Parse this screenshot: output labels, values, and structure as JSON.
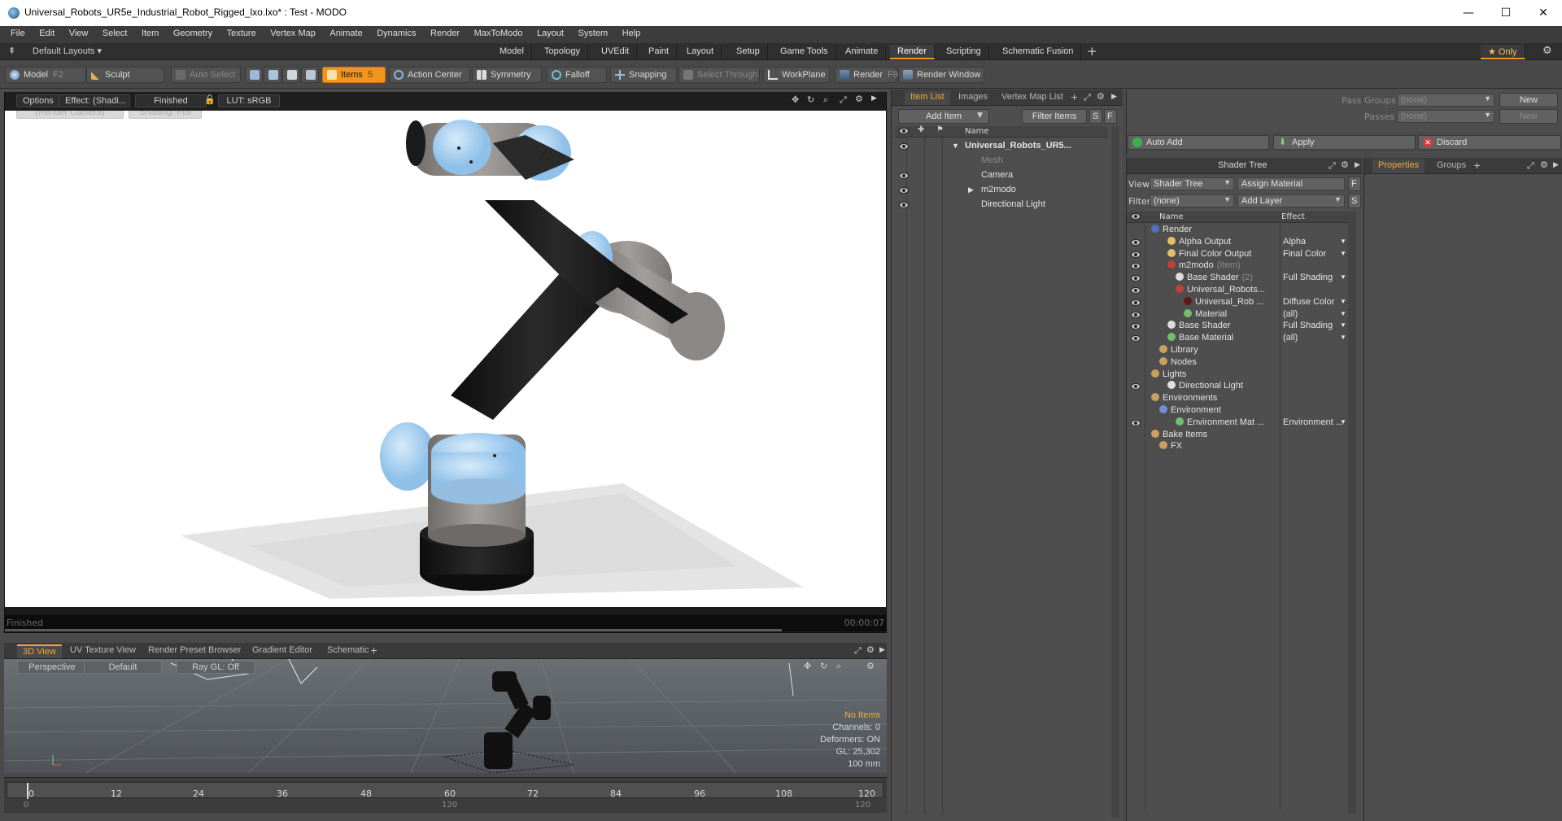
{
  "window": {
    "title": "Universal_Robots_UR5e_Industrial_Robot_Rigged_lxo.lxo* : Test - MODO",
    "minimize": "—",
    "maximize": "☐",
    "close": "✕"
  },
  "menu": [
    "File",
    "Edit",
    "View",
    "Select",
    "Item",
    "Geometry",
    "Texture",
    "Vertex Map",
    "Animate",
    "Dynamics",
    "Render",
    "MaxToModo",
    "Layout",
    "System",
    "Help"
  ],
  "layouts": {
    "default_label": "Default Layouts ▾",
    "tabs": [
      "Model",
      "Topology",
      "UVEdit",
      "Paint",
      "Layout",
      "Setup",
      "Game Tools",
      "Animate",
      "Render",
      "Scripting",
      "Schematic Fusion"
    ],
    "active_tab": "Render",
    "add": "+",
    "only_label": "★ Only"
  },
  "toolbar": {
    "model": "Model",
    "model_key": "F2",
    "sculpt": "Sculpt",
    "auto_select": "Auto Select",
    "items": "Items",
    "items_key": "5",
    "action_center": "Action Center",
    "symmetry": "Symmetry",
    "falloff": "Falloff",
    "snapping": "Snapping",
    "select_through": "Select Through",
    "workplane": "WorkPlane",
    "render": "Render",
    "render_key": "F9",
    "render_window": "Render Window"
  },
  "viewport": {
    "options": "Options",
    "effect": "Effect: (Shadi...",
    "finished_label": "Finished",
    "lut": "LUT: sRGB",
    "camera": "(Render Camera)",
    "shading": "Shading: Full",
    "status": "Finished",
    "time": "00:00:07"
  },
  "lower_tabs": [
    "3D View",
    "UV Texture View",
    "Render Preset Browser",
    "Gradient Editor",
    "Schematic"
  ],
  "view3d": {
    "perspective": "Perspective",
    "default": "Default",
    "raygl": "Ray GL: Off",
    "no_items": "No Items",
    "channels": "Channels: 0",
    "deformers": "Deformers: ON",
    "gl": "GL: 25,302",
    "scale": "100 mm"
  },
  "timeline": {
    "ticks": [
      "0",
      "12",
      "24",
      "36",
      "48",
      "60",
      "72",
      "84",
      "96",
      "108",
      "120"
    ],
    "bottom_left": "0",
    "bottom_mid": "120",
    "bottom_right": "120"
  },
  "item_list": {
    "tabs": [
      "Item List",
      "Images",
      "Vertex Map List"
    ],
    "add_item": "Add Item",
    "filter_items": "Filter Items",
    "s": "S",
    "f": "F",
    "col_name": "Name",
    "rows": [
      {
        "label": "Universal_Robots_UR5...",
        "bold": true,
        "indent": 0
      },
      {
        "label": "Mesh",
        "muted": true,
        "indent": 1
      },
      {
        "label": "Camera",
        "indent": 1
      },
      {
        "label": "m2modo",
        "indent": 1
      },
      {
        "label": "Directional Light",
        "indent": 1
      }
    ]
  },
  "pass_groups": {
    "pass_groups_label": "Pass Groups",
    "passes_label": "Passes",
    "none1": "(none)",
    "none2": "(none)",
    "new1": "New",
    "new2": "New"
  },
  "actions": {
    "auto_add": "Auto Add",
    "apply": "Apply",
    "discard": "Discard"
  },
  "shader_tree": {
    "title": "Shader Tree",
    "view_label": "View",
    "view_value": "Shader Tree",
    "assign_material": "Assign Material",
    "filter_label": "Filter",
    "filter_value": "(none)",
    "add_layer": "Add Layer",
    "f": "F",
    "s": "S",
    "col_name": "Name",
    "col_effect": "Effect",
    "rows": [
      {
        "label": "Render",
        "effect": "",
        "eye": false,
        "indent": 0
      },
      {
        "label": "Alpha Output",
        "effect": "Alpha",
        "eye": true,
        "indent": 2
      },
      {
        "label": "Final Color Output",
        "effect": "Final Color",
        "eye": true,
        "indent": 2
      },
      {
        "label": "m2modo",
        "suffix": "(Item)",
        "effect": "",
        "eye": true,
        "indent": 2
      },
      {
        "label": "Base Shader",
        "suffix": "(2)",
        "effect": "Full Shading",
        "eye": true,
        "indent": 3
      },
      {
        "label": "Universal_Robots...",
        "effect": "",
        "eye": true,
        "indent": 3
      },
      {
        "label": "Universal_Rob ...",
        "effect": "Diffuse Color",
        "eye": true,
        "indent": 4
      },
      {
        "label": "Material",
        "effect": "(all)",
        "eye": true,
        "indent": 4
      },
      {
        "label": "Base Shader",
        "effect": "Full Shading",
        "eye": true,
        "indent": 2
      },
      {
        "label": "Base Material",
        "effect": "(all)",
        "eye": true,
        "indent": 2
      },
      {
        "label": "Library",
        "effect": "",
        "eye": false,
        "indent": 1
      },
      {
        "label": "Nodes",
        "effect": "",
        "eye": false,
        "indent": 1
      },
      {
        "label": "Lights",
        "effect": "",
        "eye": false,
        "indent": 0
      },
      {
        "label": "Directional Light",
        "effect": "",
        "eye": true,
        "indent": 2
      },
      {
        "label": "Environments",
        "effect": "",
        "eye": false,
        "indent": 0
      },
      {
        "label": "Environment",
        "effect": "",
        "eye": false,
        "indent": 1
      },
      {
        "label": "Environment Mat ...",
        "effect": "Environment ...",
        "eye": true,
        "indent": 3
      },
      {
        "label": "Bake Items",
        "effect": "",
        "eye": false,
        "indent": 0
      },
      {
        "label": "FX",
        "effect": "",
        "eye": false,
        "indent": 1
      }
    ]
  },
  "properties": {
    "tabs": [
      "Properties",
      "Groups"
    ],
    "add": "+"
  },
  "colors": {
    "accent": "#f29b20",
    "robot_cap": "#a9d4f2",
    "robot_body": "#8f8a88",
    "robot_black": "#1a1a1a"
  }
}
